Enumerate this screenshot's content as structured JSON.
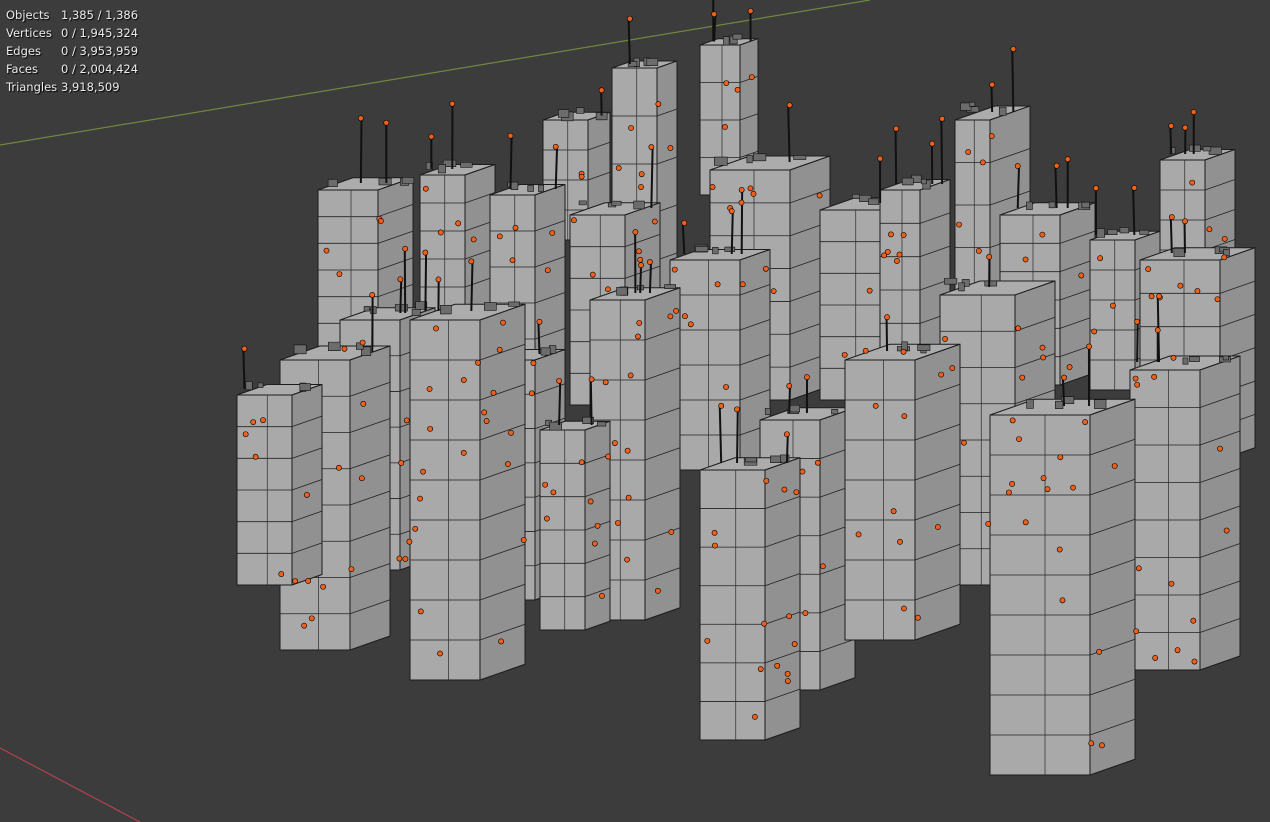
{
  "statistics": [
    {
      "label": "Objects",
      "value": "1,385 / 1,386"
    },
    {
      "label": "Vertices",
      "value": "0 / 1,945,324"
    },
    {
      "label": "Edges",
      "value": "0 / 3,953,959"
    },
    {
      "label": "Faces",
      "value": "0 / 2,004,424"
    },
    {
      "label": "Triangles",
      "value": "3,918,509"
    }
  ],
  "colors": {
    "background": "#3c3c3c",
    "x_axis": "#b0434e",
    "y_axis": "#6d8a3c",
    "mesh_face": "#a9a9a9",
    "mesh_edge": "#1a1a1a",
    "selected_origin": "#f0601a"
  }
}
